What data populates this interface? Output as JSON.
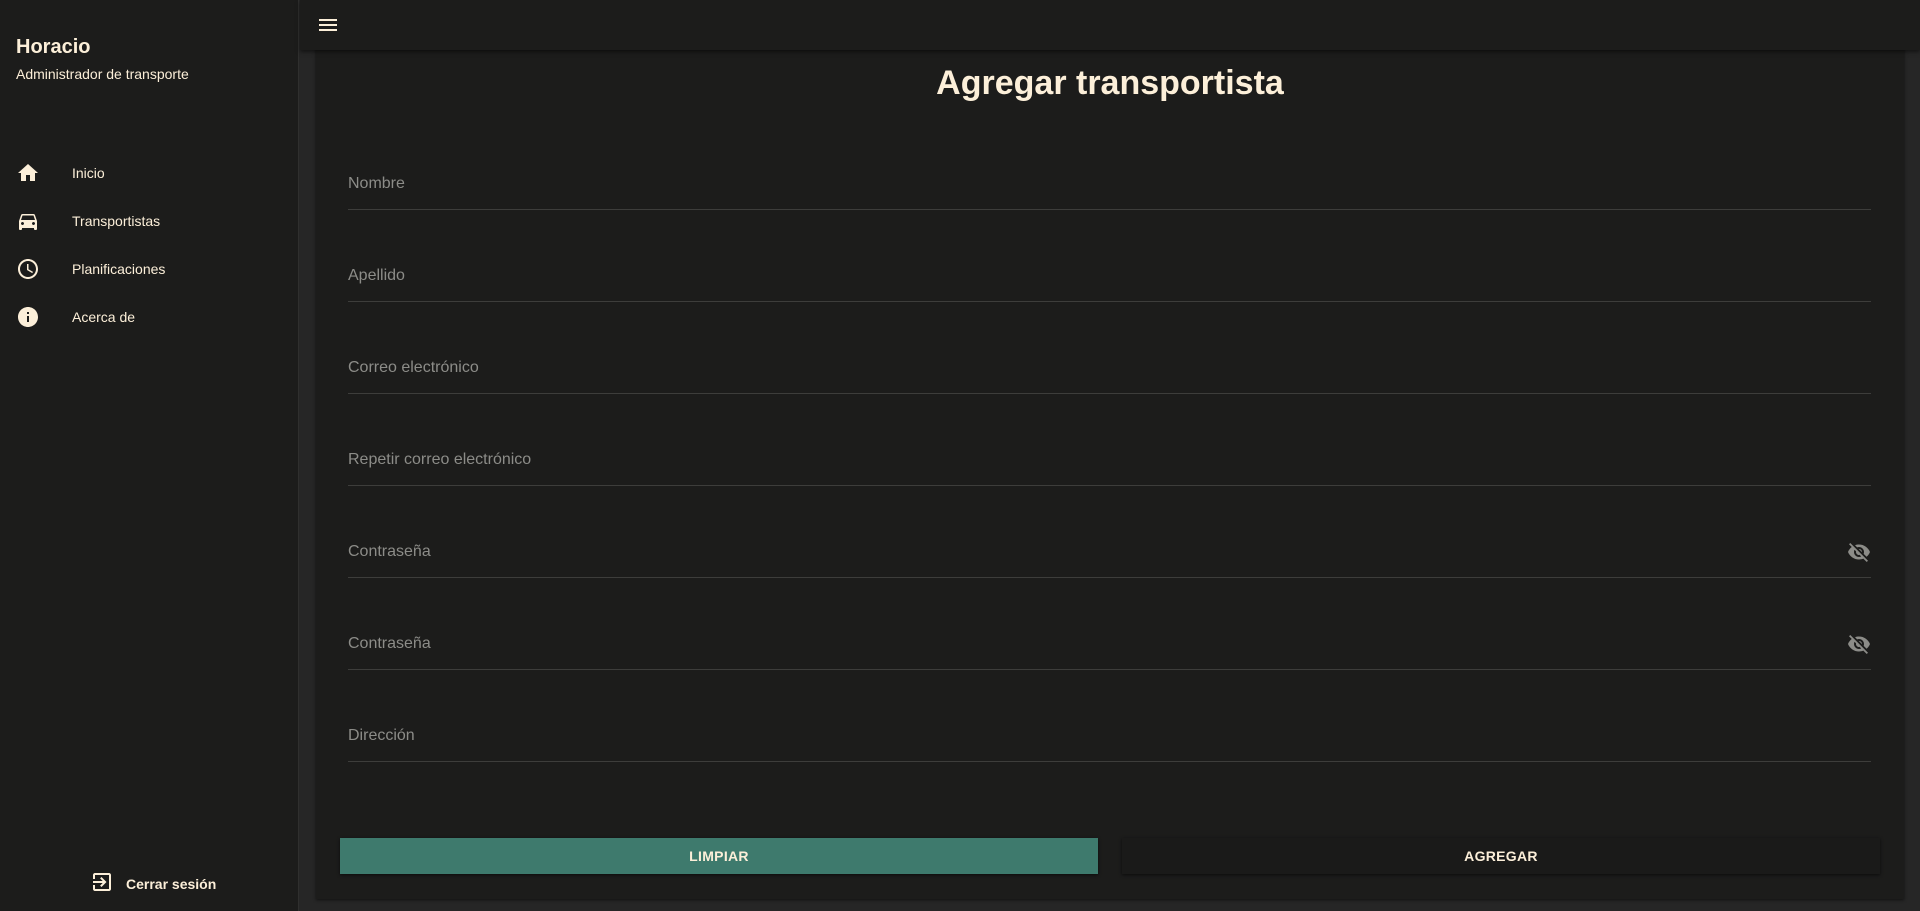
{
  "sidebar": {
    "user_name": "Horacio",
    "user_role": "Administrador de transporte",
    "items": [
      {
        "label": "Inicio",
        "icon": "home-icon"
      },
      {
        "label": "Transportistas",
        "icon": "car-icon"
      },
      {
        "label": "Planificaciones",
        "icon": "clock-icon"
      },
      {
        "label": "Acerca de",
        "icon": "info-icon"
      }
    ],
    "logout_label": "Cerrar sesión"
  },
  "topbar": {
    "menu_icon": "menu-icon"
  },
  "form": {
    "title": "Agregar transportista",
    "fields": {
      "nombre": {
        "placeholder": "Nombre",
        "value": ""
      },
      "apellido": {
        "placeholder": "Apellido",
        "value": ""
      },
      "correo": {
        "placeholder": "Correo electrónico",
        "value": ""
      },
      "repetir_correo": {
        "placeholder": "Repetir correo electrónico",
        "value": ""
      },
      "contrasena": {
        "placeholder": "Contraseña",
        "value": ""
      },
      "repetir_contrasena": {
        "placeholder": "Contraseña",
        "value": ""
      },
      "direccion": {
        "placeholder": "Dirección",
        "value": ""
      }
    },
    "clear_label": "LIMPIAR",
    "submit_label": "AGREGAR"
  },
  "colors": {
    "background": "#262626",
    "surface": "#1c1c1b",
    "text": "#fcefd9",
    "muted": "#8c8c88",
    "accent": "#3e7a6d"
  }
}
